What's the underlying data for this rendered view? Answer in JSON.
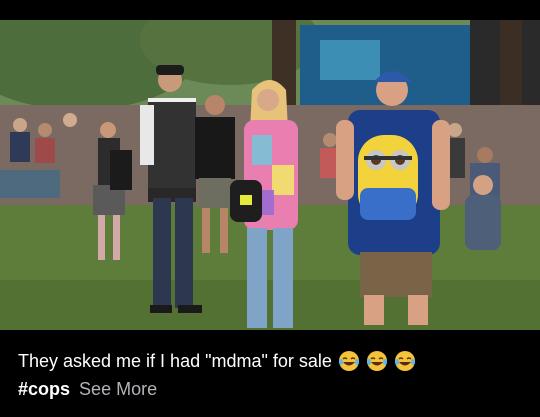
{
  "caption": {
    "text": "They asked me if I had \"mdma\" for sale",
    "emojis": [
      "laughing-tears-icon",
      "laughing-tears-icon",
      "laughing-tears-icon"
    ],
    "hashtag": "#cops",
    "see_more": "See More"
  },
  "photo": {
    "minion_backpack_text": "",
    "colors": {
      "sky_trees": "#2f4a2a",
      "grass": "#5f7d3a",
      "crowd": "#6b5a55",
      "stage": "#1f5e8a"
    }
  }
}
